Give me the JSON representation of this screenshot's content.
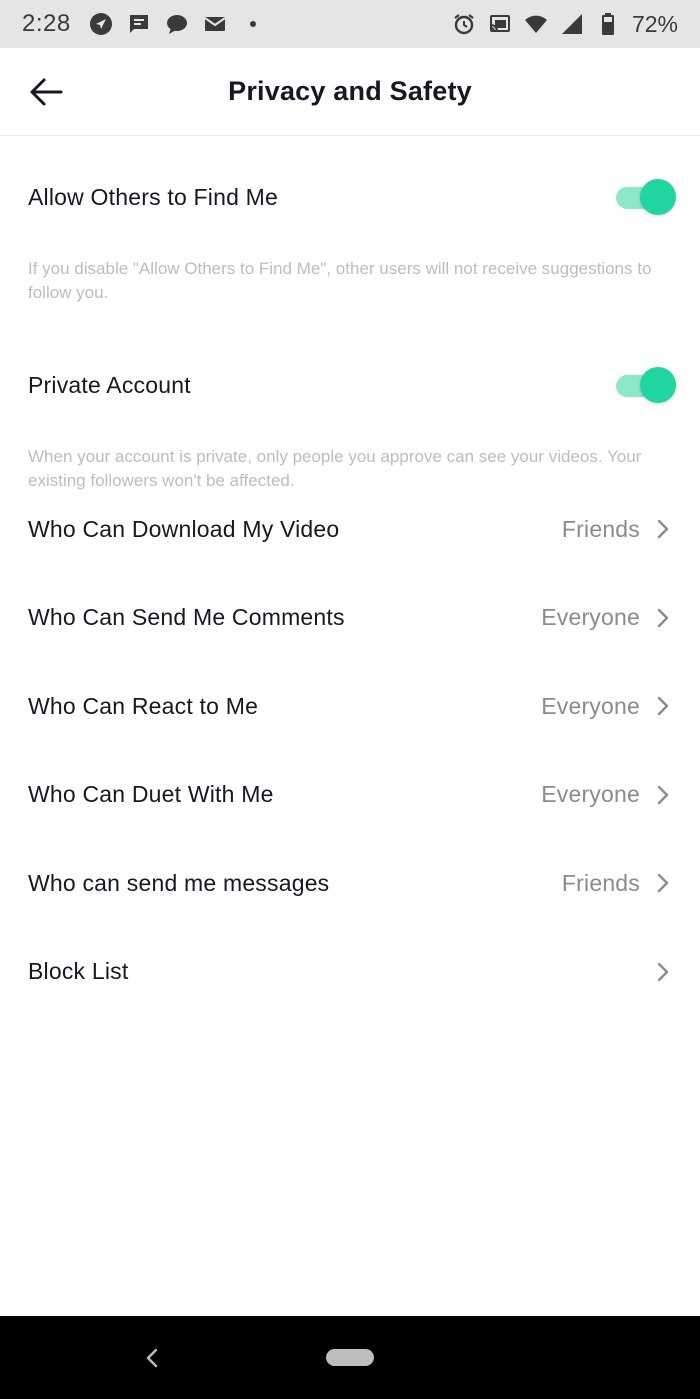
{
  "status_bar": {
    "time": "2:28",
    "battery": "72%",
    "left_icons": [
      "navigation-icon",
      "message-icon",
      "chat-bubble-icon",
      "mail-icon",
      "dot-icon"
    ],
    "right_icons": [
      "alarm-icon",
      "cast-icon",
      "wifi-icon",
      "signal-icon",
      "battery-icon"
    ]
  },
  "header": {
    "title": "Privacy and Safety",
    "back_icon": "arrow-left-icon"
  },
  "toggles": [
    {
      "label": "Allow Others to Find Me",
      "enabled": true,
      "description": "If you disable \"Allow Others to Find Me\", other users will not receive suggestions to follow you."
    },
    {
      "label": "Private Account",
      "enabled": true,
      "description": "When your account is private, only people you approve can see your videos. Your existing followers won't be affected."
    }
  ],
  "settings": [
    {
      "label": "Who Can Download My Video",
      "value": "Friends"
    },
    {
      "label": "Who Can Send Me Comments",
      "value": "Everyone"
    },
    {
      "label": "Who Can React to Me",
      "value": "Everyone"
    },
    {
      "label": "Who Can Duet With Me",
      "value": "Everyone"
    },
    {
      "label": "Who can send me messages",
      "value": "Friends"
    },
    {
      "label": "Block List",
      "value": ""
    }
  ],
  "colors": {
    "toggle_knob": "#20d5a0",
    "toggle_track": "#8de8c8",
    "status_bar": "#e5e5e7",
    "nav_bar": "#000000"
  }
}
